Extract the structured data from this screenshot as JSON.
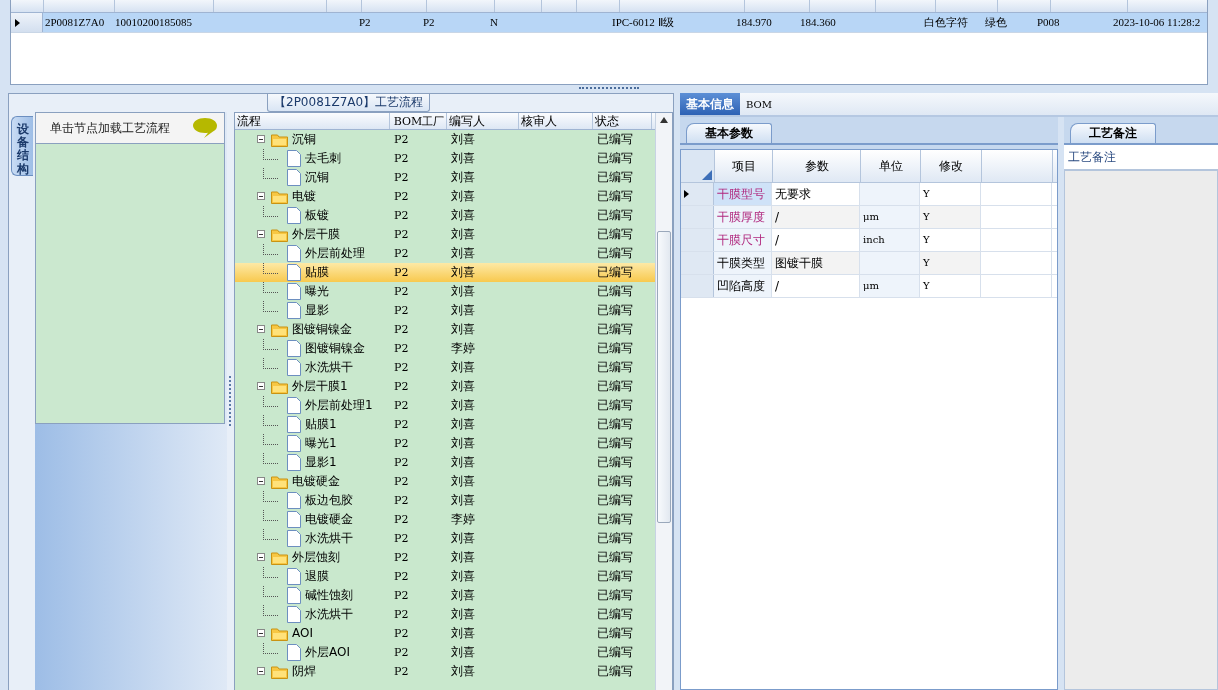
{
  "top_grid": {
    "rows": [
      {
        "selected": true,
        "cells": [
          "2P0081Z7A0",
          "10010200185085",
          null,
          null,
          "P2",
          "P2",
          "N",
          null,
          null,
          "IPC-6012 Ⅱ级",
          "184.970",
          "184.360",
          null,
          "白色字符",
          "绿色",
          "P008",
          "2023-10-06 11:28:2"
        ]
      }
    ]
  },
  "process_panel": {
    "title": "【2P0081Z7A0】工艺流程",
    "side_tab": "设备结构",
    "hint": "单击节点加载工艺流程",
    "tree": {
      "columns": [
        "流程",
        "BOM工厂",
        "编写人",
        "核审人",
        "状态"
      ],
      "rows": [
        {
          "name": "沉铜",
          "factory": "P2",
          "writer": "刘喜",
          "status": "已编写",
          "selected": false,
          "expanded": true,
          "children": [
            {
              "name": "去毛刺",
              "factory": "P2",
              "writer": "刘喜",
              "status": "已编写",
              "selected": false
            },
            {
              "name": "沉铜",
              "factory": "P2",
              "writer": "刘喜",
              "status": "已编写",
              "selected": false
            }
          ]
        },
        {
          "name": "电镀",
          "factory": "P2",
          "writer": "刘喜",
          "status": "已编写",
          "selected": false,
          "expanded": true,
          "children": [
            {
              "name": "板镀",
              "factory": "P2",
              "writer": "刘喜",
              "status": "已编写",
              "selected": false
            }
          ]
        },
        {
          "name": "外层干膜",
          "factory": "P2",
          "writer": "刘喜",
          "status": "已编写",
          "selected": false,
          "expanded": true,
          "children": [
            {
              "name": "外层前处理",
              "factory": "P2",
              "writer": "刘喜",
              "status": "已编写",
              "selected": false
            },
            {
              "name": "贴膜",
              "factory": "P2",
              "writer": "刘喜",
              "status": "已编写",
              "selected": true
            },
            {
              "name": "曝光",
              "factory": "P2",
              "writer": "刘喜",
              "status": "已编写",
              "selected": false
            },
            {
              "name": "显影",
              "factory": "P2",
              "writer": "刘喜",
              "status": "已编写",
              "selected": false
            }
          ]
        },
        {
          "name": "图镀铜镍金",
          "factory": "P2",
          "writer": "刘喜",
          "status": "已编写",
          "selected": false,
          "expanded": true,
          "children": [
            {
              "name": "图镀铜镍金",
              "factory": "P2",
              "writer": "李婷",
              "status": "已编写",
              "selected": false
            },
            {
              "name": "水洗烘干",
              "factory": "P2",
              "writer": "刘喜",
              "status": "已编写",
              "selected": false
            }
          ]
        },
        {
          "name": "外层干膜1",
          "factory": "P2",
          "writer": "刘喜",
          "status": "已编写",
          "selected": false,
          "expanded": true,
          "children": [
            {
              "name": "外层前处理1",
              "factory": "P2",
              "writer": "刘喜",
              "status": "已编写",
              "selected": false
            },
            {
              "name": "贴膜1",
              "factory": "P2",
              "writer": "刘喜",
              "status": "已编写",
              "selected": false
            },
            {
              "name": "曝光1",
              "factory": "P2",
              "writer": "刘喜",
              "status": "已编写",
              "selected": false
            },
            {
              "name": "显影1",
              "factory": "P2",
              "writer": "刘喜",
              "status": "已编写",
              "selected": false
            }
          ]
        },
        {
          "name": "电镀硬金",
          "factory": "P2",
          "writer": "刘喜",
          "status": "已编写",
          "selected": false,
          "expanded": true,
          "children": [
            {
              "name": "板边包胶",
              "factory": "P2",
              "writer": "刘喜",
              "status": "已编写",
              "selected": false
            },
            {
              "name": "电镀硬金",
              "factory": "P2",
              "writer": "李婷",
              "status": "已编写",
              "selected": false
            },
            {
              "name": "水洗烘干",
              "factory": "P2",
              "writer": "刘喜",
              "status": "已编写",
              "selected": false
            }
          ]
        },
        {
          "name": "外层蚀刻",
          "factory": "P2",
          "writer": "刘喜",
          "status": "已编写",
          "selected": false,
          "expanded": true,
          "children": [
            {
              "name": "退膜",
              "factory": "P2",
              "writer": "刘喜",
              "status": "已编写",
              "selected": false
            },
            {
              "name": "碱性蚀刻",
              "factory": "P2",
              "writer": "刘喜",
              "status": "已编写",
              "selected": false
            },
            {
              "name": "水洗烘干",
              "factory": "P2",
              "writer": "刘喜",
              "status": "已编写",
              "selected": false
            }
          ]
        },
        {
          "name": "AOI",
          "factory": "P2",
          "writer": "刘喜",
          "status": "已编写",
          "selected": false,
          "expanded": true,
          "children": [
            {
              "name": "外层AOI",
              "factory": "P2",
              "writer": "刘喜",
              "status": "已编写",
              "selected": false
            }
          ]
        },
        {
          "name": "阴焊",
          "factory": "P2",
          "writer": "刘喜",
          "status": "已编写",
          "selected": false,
          "expanded": true
        }
      ]
    }
  },
  "detail_panel": {
    "tabs": [
      {
        "label": "基本信息",
        "selected": true
      },
      {
        "label": "BOM",
        "selected": false
      }
    ],
    "params": {
      "tab": "基本参数",
      "columns": [
        "项目",
        "参数",
        "单位",
        "修改"
      ],
      "rows": [
        {
          "item": "干膜型号",
          "value": "无要求",
          "modified": "Y",
          "emphasized": true,
          "selected": true
        },
        {
          "item": "干膜厚度",
          "value": "/",
          "unit": "μm",
          "modified": "Y",
          "emphasized": true,
          "selected": false
        },
        {
          "item": "干膜尺寸",
          "value": "/",
          "unit": "inch",
          "modified": "Y",
          "emphasized": true,
          "selected": false
        },
        {
          "item": "干膜类型",
          "value": "图镀干膜",
          "modified": "Y",
          "emphasized": false,
          "selected": false
        },
        {
          "item": "凹陷高度",
          "value": "/",
          "unit": "μm",
          "modified": "Y",
          "emphasized": false,
          "selected": false
        }
      ]
    },
    "notes": {
      "tab": "工艺备注",
      "header": "工艺备注"
    }
  }
}
